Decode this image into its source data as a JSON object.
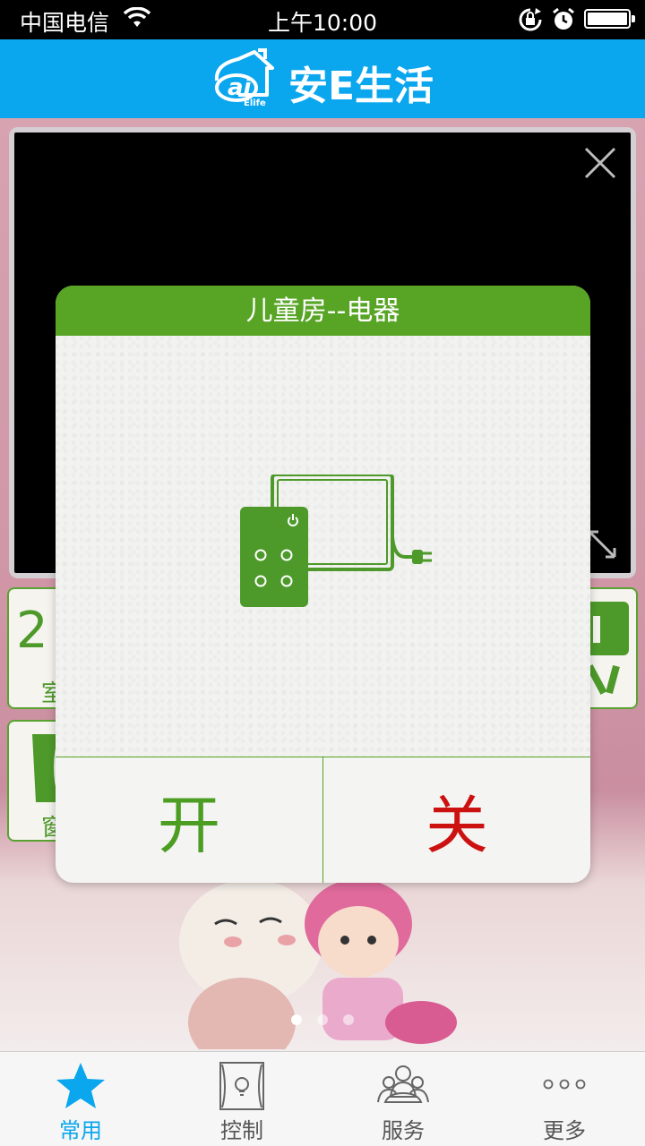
{
  "status_bar": {
    "carrier": "中国电信",
    "time": "上午10:00",
    "battery_level": 1.0
  },
  "header": {
    "title": "安E生活",
    "logo_text": "ai",
    "logo_subtext": "Elife"
  },
  "background": {
    "temperature_fragment": "2",
    "tile_label_1": "室",
    "tile_label_2": "窗"
  },
  "modal": {
    "title": "儿童房--电器",
    "device_icon": "power-strip-icon",
    "on_label": "开",
    "off_label": "关"
  },
  "pager": {
    "count": 3,
    "active_index": 0
  },
  "tabs": [
    {
      "label": "常用",
      "icon": "star-icon",
      "active": true
    },
    {
      "label": "控制",
      "icon": "curtain-lamp-icon",
      "active": false
    },
    {
      "label": "服务",
      "icon": "people-icon",
      "active": false
    },
    {
      "label": "更多",
      "icon": "more-dots-icon",
      "active": false
    }
  ],
  "colors": {
    "accent_blue": "#0aa6ee",
    "accent_green": "#58a425",
    "off_red": "#cc1111"
  }
}
